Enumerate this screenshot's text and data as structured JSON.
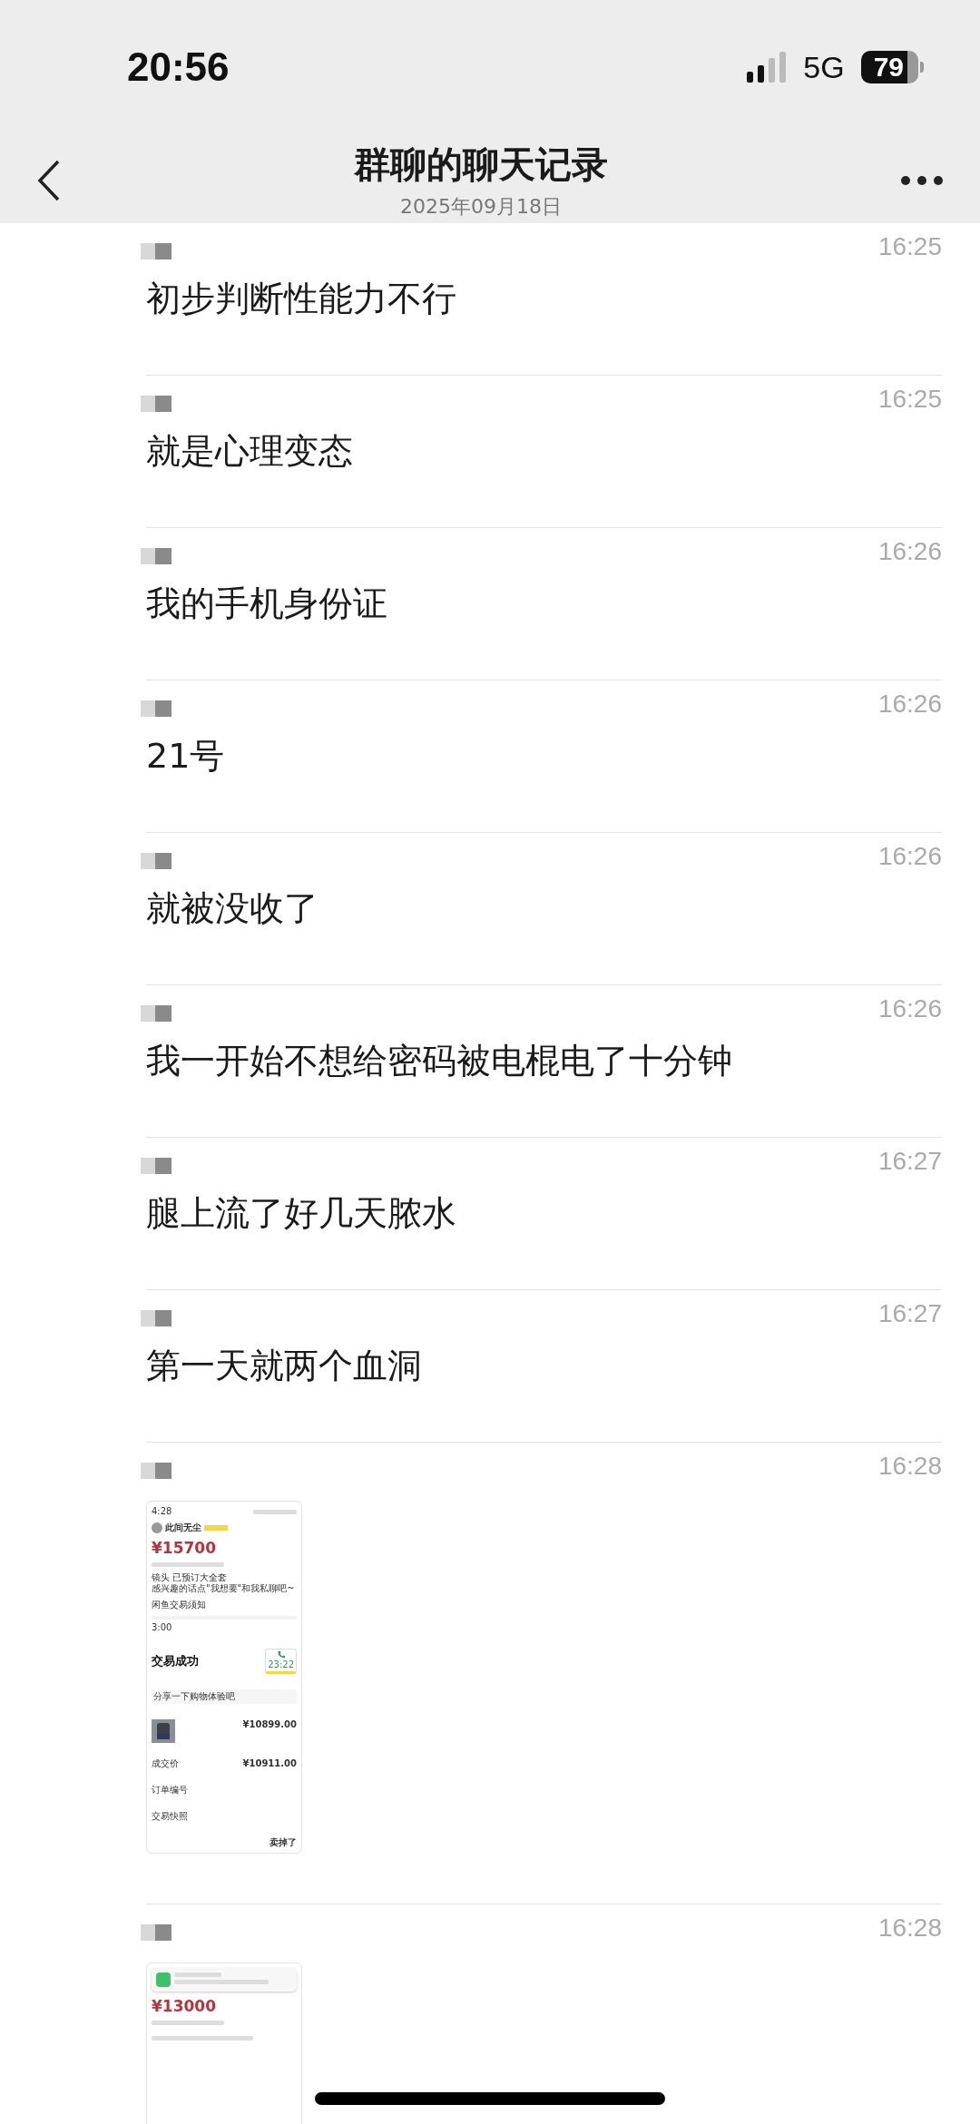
{
  "status_bar": {
    "time": "20:56",
    "network": "5G",
    "battery": "79"
  },
  "header": {
    "title": "群聊的聊天记录",
    "date": "2025年09月18日"
  },
  "messages": [
    {
      "kind": "text",
      "time": "16:25",
      "text": "初步判断性能力不行"
    },
    {
      "kind": "text",
      "time": "16:25",
      "text": "就是心理变态"
    },
    {
      "kind": "text",
      "time": "16:26",
      "text": "我的手机身份证"
    },
    {
      "kind": "text",
      "time": "16:26",
      "text": "21号"
    },
    {
      "kind": "text",
      "time": "16:26",
      "text": "就被没收了"
    },
    {
      "kind": "text",
      "time": "16:26",
      "text": "我一开始不想给密码被电棍电了十分钟"
    },
    {
      "kind": "text",
      "time": "16:27",
      "text": "腿上流了好几天脓水"
    },
    {
      "kind": "text",
      "time": "16:27",
      "text": "第一天就两个血洞"
    },
    {
      "time": "16:28",
      "screenshot": {
        "time": "4:28",
        "seller": "此间无尘",
        "price": "¥15700",
        "lines": [
          "镜头 已预订大全套",
          "感兴趣的话点\"我想要\"和我私聊吧~"
        ],
        "notice": "闲鱼交易须知",
        "order": {
          "time": "3:00",
          "status": "交易成功",
          "call_time": "23:22",
          "share": "分享一下购物体验吧",
          "item_price": "¥10899.00",
          "deal_label": "成交价",
          "deal_price": "¥10911.00",
          "rows": [
            "订单编号",
            "交易快照"
          ],
          "button": "卖掉了"
        }
      }
    },
    {
      "time": "16:28",
      "screenshot": {
        "notification": true,
        "price": "¥13000"
      }
    }
  ]
}
